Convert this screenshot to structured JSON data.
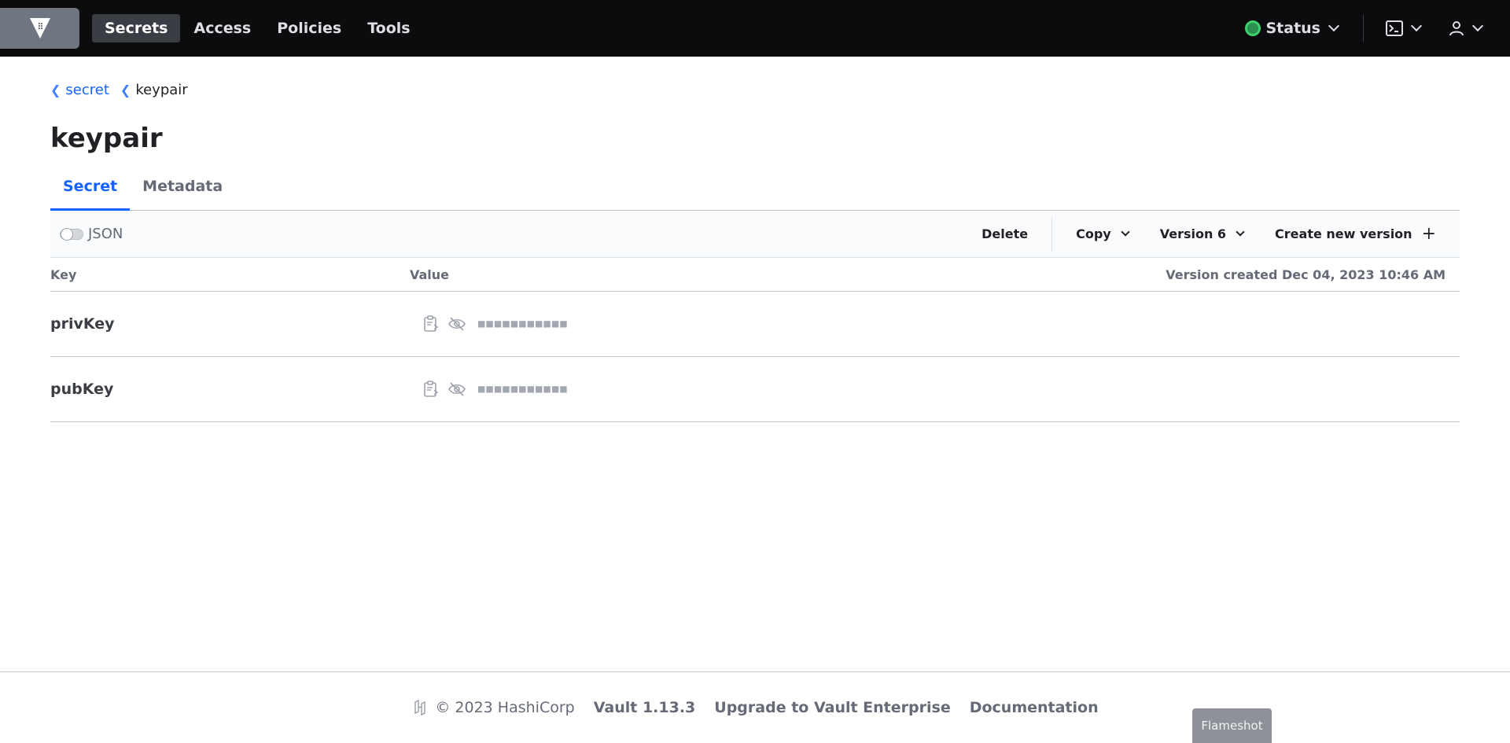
{
  "nav": {
    "links": [
      "Secrets",
      "Access",
      "Policies",
      "Tools"
    ],
    "status_label": "Status",
    "status_color": "#3bd16f"
  },
  "breadcrumb": {
    "parent": "secret",
    "current": "keypair"
  },
  "page": {
    "title": "keypair",
    "tabs": [
      "Secret",
      "Metadata"
    ],
    "active_tab": "Secret"
  },
  "toolbar": {
    "json_toggle_label": "JSON",
    "json_toggle_on": false,
    "delete_label": "Delete",
    "copy_label": "Copy",
    "version_label": "Version 6",
    "create_label": "Create new version"
  },
  "table": {
    "headers": {
      "key": "Key",
      "value": "Value",
      "meta": "Version created Dec 04, 2023 10:46 AM"
    },
    "rows": [
      {
        "key": "privKey",
        "masked": "■■■■■■■■■■■"
      },
      {
        "key": "pubKey",
        "masked": "■■■■■■■■■■■"
      }
    ]
  },
  "footer": {
    "copyright": "© 2023 HashiCorp",
    "version": "Vault 1.13.3",
    "upgrade": "Upgrade to Vault Enterprise",
    "docs": "Documentation"
  },
  "overlay": {
    "flameshot": "Flameshot"
  },
  "colors": {
    "accent": "#1563ff",
    "nav_bg": "#0c0c0e"
  }
}
